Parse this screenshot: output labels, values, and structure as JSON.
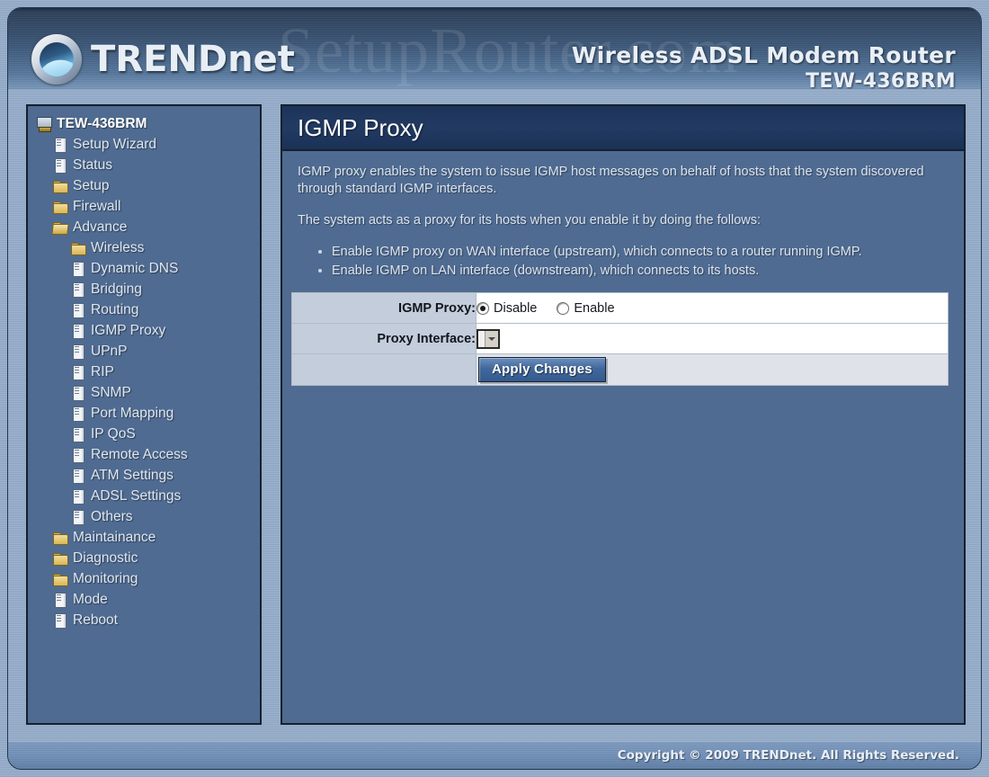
{
  "header": {
    "watermark": "SetupRouter.com",
    "brand": "TRENDnet",
    "brand_icon": "trendnet-logo-icon",
    "product_line1": "Wireless ADSL Modem Router",
    "product_line2": "TEW-436BRM"
  },
  "sidebar": {
    "items": [
      {
        "label": "TEW-436BRM",
        "icon": "computer-icon",
        "level": 0,
        "type": "root"
      },
      {
        "label": "Setup Wizard",
        "icon": "document-icon",
        "level": 1,
        "type": "page"
      },
      {
        "label": "Status",
        "icon": "document-icon",
        "level": 1,
        "type": "page"
      },
      {
        "label": "Setup",
        "icon": "folder-icon",
        "level": 1,
        "type": "folder"
      },
      {
        "label": "Firewall",
        "icon": "folder-icon",
        "level": 1,
        "type": "folder"
      },
      {
        "label": "Advance",
        "icon": "folder-open-icon",
        "level": 1,
        "type": "folder-open"
      },
      {
        "label": "Wireless",
        "icon": "folder-icon",
        "level": 2,
        "type": "folder"
      },
      {
        "label": "Dynamic DNS",
        "icon": "document-icon",
        "level": 2,
        "type": "page"
      },
      {
        "label": "Bridging",
        "icon": "document-icon",
        "level": 2,
        "type": "page"
      },
      {
        "label": "Routing",
        "icon": "document-icon",
        "level": 2,
        "type": "page"
      },
      {
        "label": "IGMP Proxy",
        "icon": "document-icon",
        "level": 2,
        "type": "page"
      },
      {
        "label": "UPnP",
        "icon": "document-icon",
        "level": 2,
        "type": "page"
      },
      {
        "label": "RIP",
        "icon": "document-icon",
        "level": 2,
        "type": "page"
      },
      {
        "label": "SNMP",
        "icon": "document-icon",
        "level": 2,
        "type": "page"
      },
      {
        "label": "Port Mapping",
        "icon": "document-icon",
        "level": 2,
        "type": "page"
      },
      {
        "label": "IP QoS",
        "icon": "document-icon",
        "level": 2,
        "type": "page"
      },
      {
        "label": "Remote Access",
        "icon": "document-icon",
        "level": 2,
        "type": "page"
      },
      {
        "label": "ATM Settings",
        "icon": "document-icon",
        "level": 2,
        "type": "page"
      },
      {
        "label": "ADSL Settings",
        "icon": "document-icon",
        "level": 2,
        "type": "page"
      },
      {
        "label": "Others",
        "icon": "document-icon",
        "level": 2,
        "type": "page"
      },
      {
        "label": "Maintainance",
        "icon": "folder-icon",
        "level": 1,
        "type": "folder"
      },
      {
        "label": "Diagnostic",
        "icon": "folder-icon",
        "level": 1,
        "type": "folder"
      },
      {
        "label": "Monitoring",
        "icon": "folder-icon",
        "level": 1,
        "type": "folder"
      },
      {
        "label": "Mode",
        "icon": "document-icon",
        "level": 1,
        "type": "page"
      },
      {
        "label": "Reboot",
        "icon": "document-icon",
        "level": 1,
        "type": "page"
      }
    ]
  },
  "main": {
    "title": "IGMP Proxy",
    "paragraph1": "IGMP proxy enables the system to issue IGMP host messages on behalf of hosts that the system discovered through standard IGMP interfaces.",
    "paragraph2": "The system acts as a proxy for its hosts when you enable it by doing the follows:",
    "bullets": [
      "Enable IGMP proxy on WAN interface (upstream), which connects to a router running IGMP.",
      "Enable IGMP on LAN interface (downstream), which connects to its hosts."
    ],
    "form": {
      "igmp_proxy_label": "IGMP Proxy:",
      "igmp_proxy_options": [
        "Disable",
        "Enable"
      ],
      "igmp_proxy_selected": "Disable",
      "proxy_interface_label": "Proxy Interface:",
      "proxy_interface_value": "",
      "proxy_interface_options": [],
      "apply_label": "Apply Changes"
    }
  },
  "footer": {
    "copyright": "Copyright © 2009 TRENDnet. All Rights Reserved."
  },
  "colors": {
    "panel_bg": "#4f6b91",
    "title_bar": "#1d3359",
    "label_cell": "#c3cddb",
    "accent_button": "#41689c"
  }
}
